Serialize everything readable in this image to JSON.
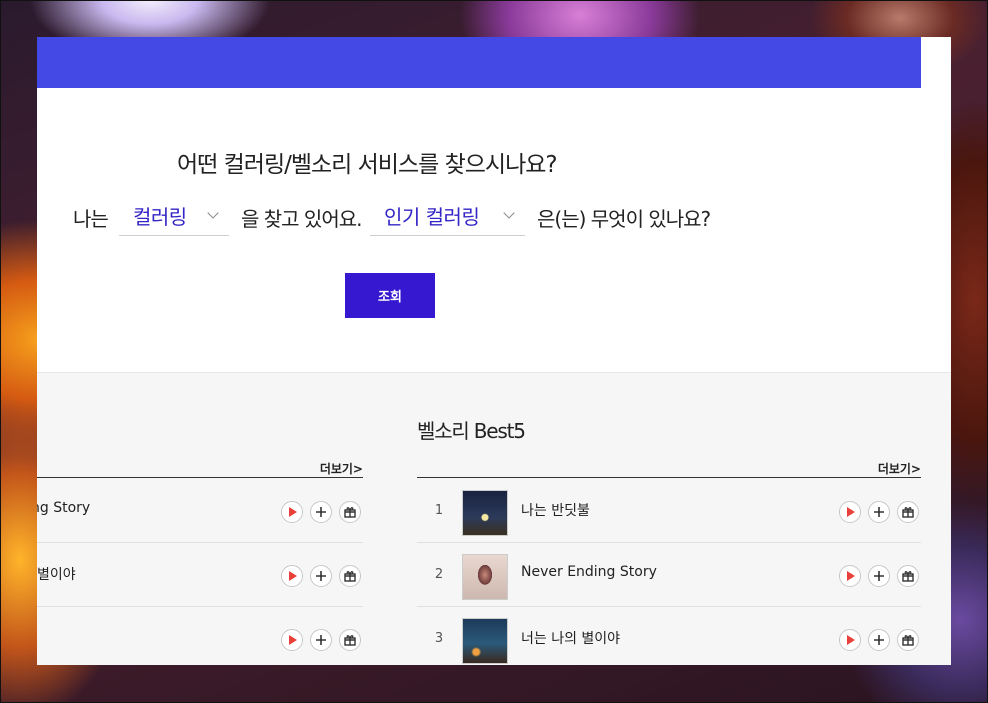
{
  "finder": {
    "question": "어떤 컬러링/벨소리 서비스를 찾으시나요?",
    "prefix": "나는",
    "type_value": "컬러링",
    "middle": "을 찾고 있어요.",
    "category_value": "인기 컬러링",
    "suffix": "은(는) 무엇이 있나요?",
    "search_label": "조회"
  },
  "left_list": {
    "more_label": "더보기>",
    "rows": [
      {
        "title": "ng Story"
      },
      {
        "title": "별이야"
      },
      {
        "title": ""
      }
    ]
  },
  "bell_best": {
    "title": "벨소리 Best5",
    "more_label": "더보기>",
    "rows": [
      {
        "rank": "1",
        "title": "나는 반딧불"
      },
      {
        "rank": "2",
        "title": "Never Ending Story"
      },
      {
        "rank": "3",
        "title": "너는 나의 별이야"
      }
    ]
  },
  "colors": {
    "accent": "#4449e6",
    "button": "#3518cf",
    "play": "#e8403a"
  }
}
